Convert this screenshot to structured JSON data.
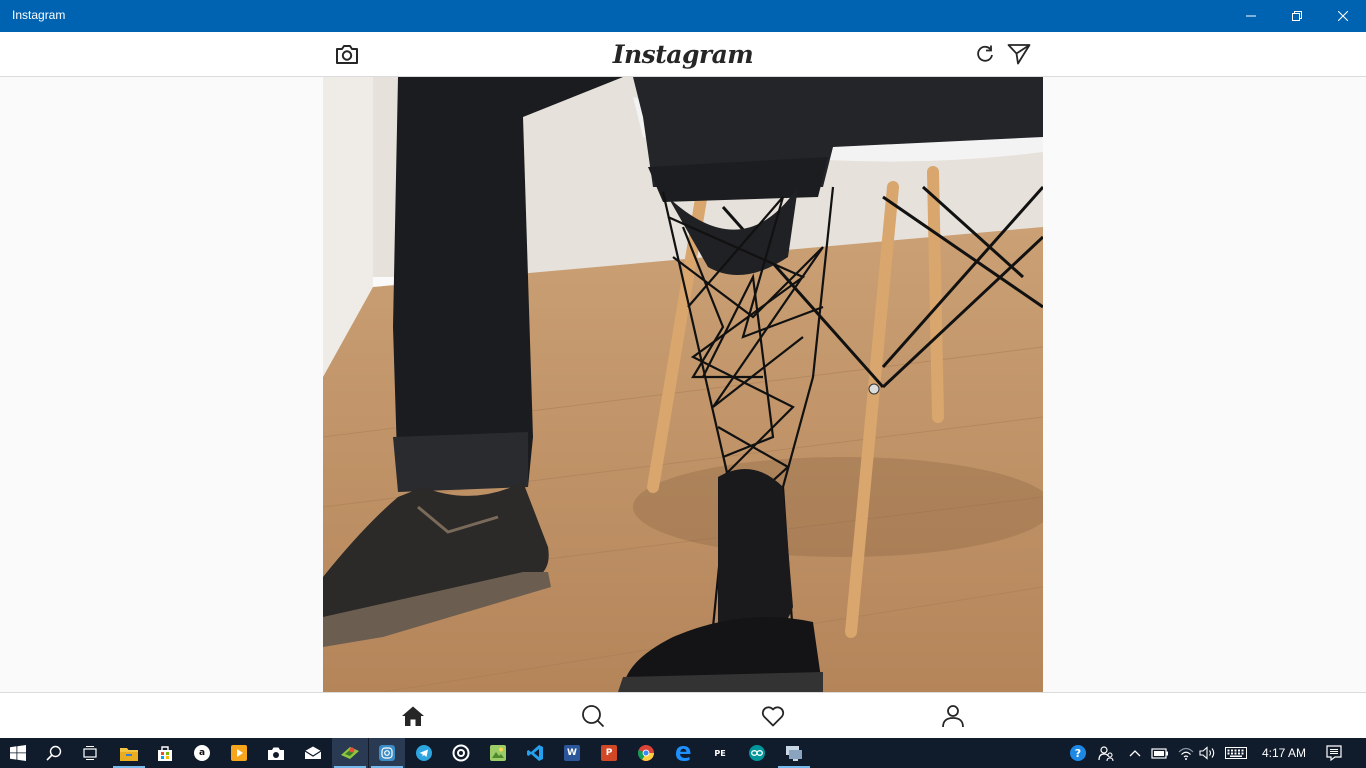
{
  "window": {
    "title": "Instagram",
    "accent": "#0063b1"
  },
  "header": {
    "logo_text": "Instagram",
    "camera_icon": "camera-icon",
    "refresh_icon": "refresh-icon",
    "direct_icon": "paper-plane-icon"
  },
  "post": {
    "image_description_visible": false
  },
  "bottom_nav": {
    "items": [
      {
        "name": "home",
        "icon": "home-icon",
        "active": true
      },
      {
        "name": "search",
        "icon": "search-icon",
        "active": false
      },
      {
        "name": "activity",
        "icon": "heart-icon",
        "active": false
      },
      {
        "name": "profile",
        "icon": "person-icon",
        "active": false
      }
    ]
  },
  "taskbar": {
    "start_icon": "windows-icon",
    "pinned": [
      {
        "icon": "search-icon"
      },
      {
        "icon": "task-view-icon"
      },
      {
        "icon": "file-explorer-icon",
        "active": true
      },
      {
        "icon": "store-icon"
      },
      {
        "icon": "amazon-icon",
        "label": "a"
      },
      {
        "icon": "media-player-icon"
      },
      {
        "icon": "camera-icon"
      },
      {
        "icon": "mail-icon"
      },
      {
        "icon": "maps-icon",
        "active": true
      },
      {
        "icon": "instagram-icon",
        "active": true
      },
      {
        "icon": "telegram-icon"
      },
      {
        "icon": "disc-icon"
      },
      {
        "icon": "photos-icon"
      },
      {
        "icon": "vscode-icon"
      },
      {
        "icon": "word-icon",
        "label": "W"
      },
      {
        "icon": "powerpoint-icon",
        "label": "P"
      },
      {
        "icon": "chrome-icon"
      },
      {
        "icon": "edge-icon"
      },
      {
        "icon": "pe-icon",
        "label": "PE"
      },
      {
        "icon": "arduino-icon"
      },
      {
        "icon": "remote-desktop-icon",
        "active": true
      }
    ],
    "tray": {
      "icons": [
        "help-icon",
        "people-icon",
        "chevron-up-icon",
        "battery-icon",
        "wifi-icon",
        "volume-icon",
        "keyboard-icon"
      ],
      "clock": "4:17 AM",
      "notification_icon": "action-center-icon"
    }
  }
}
